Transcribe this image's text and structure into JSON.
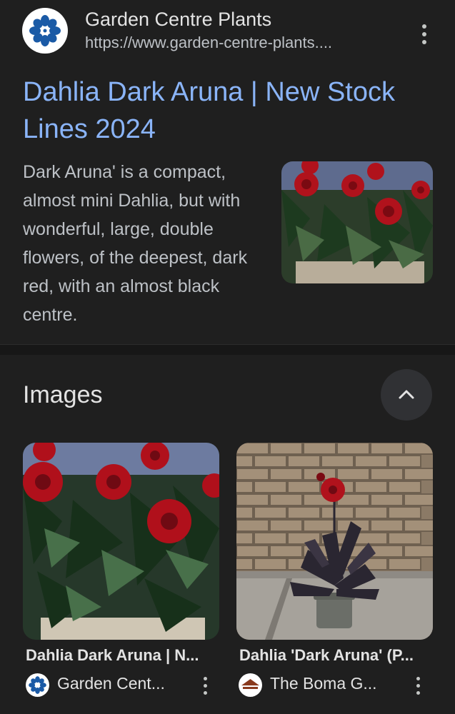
{
  "result": {
    "site_name": "Garden Centre Plants",
    "site_url": "https://www.garden-centre-plants....",
    "title": "Dahlia Dark Aruna | New Stock Lines 2024",
    "snippet": "Dark Aruna' is a compact, almost mini Dahlia, but with wonderful, large, double flowers, of the deepest, dark red, with an almost black centre.",
    "favicon_icon": "blue-flower-icon"
  },
  "images_section": {
    "heading": "Images",
    "collapse_icon": "chevron-up-icon",
    "cards": [
      {
        "title": "Dahlia Dark Aruna | N...",
        "source": "Garden Cent...",
        "source_icon": "blue-flower-icon"
      },
      {
        "title": "Dahlia 'Dark Aruna' (P...",
        "source": "The Boma G...",
        "source_icon": "boma-roof-icon"
      }
    ]
  },
  "colors": {
    "background": "#1f1f1f",
    "link": "#8ab4f8",
    "text": "#e3e3e3",
    "muted": "#bdc1c6"
  }
}
